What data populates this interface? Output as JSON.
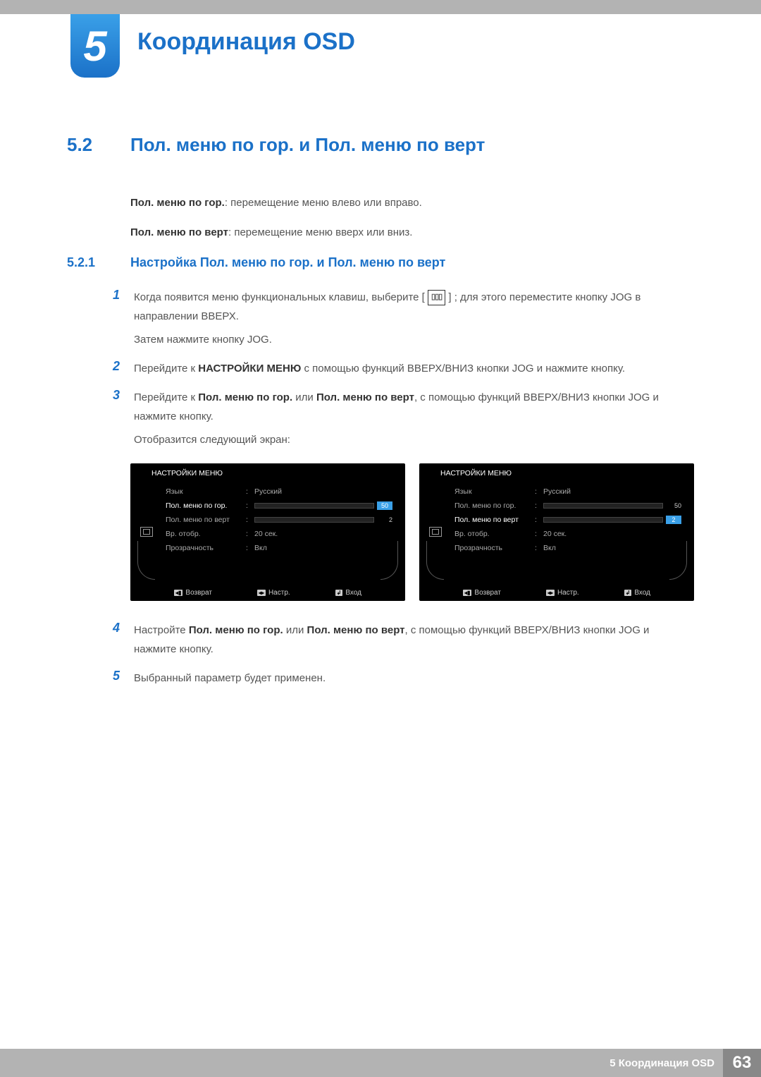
{
  "chapter": {
    "number": "5",
    "title": "Координация OSD"
  },
  "section": {
    "number": "5.2",
    "title": "Пол. меню по гор. и Пол. меню по верт"
  },
  "intro": {
    "line1_bold": "Пол. меню по гор.",
    "line1_rest": ": перемещение меню влево или вправо.",
    "line2_bold": "Пол. меню по верт",
    "line2_rest": ": перемещение меню вверх или вниз."
  },
  "subsection": {
    "number": "5.2.1",
    "title": "Настройка Пол. меню по гор. и Пол. меню по верт"
  },
  "steps": [
    {
      "num": "1",
      "pre": "Когда появится меню функциональных клавиш, выберите [",
      "post": "] ; для этого переместите кнопку JOG в направлении ВВЕРХ.",
      "sub": "Затем нажмите кнопку JOG."
    },
    {
      "num": "2",
      "t1": "Перейдите к ",
      "b1": "НАСТРОЙКИ МЕНЮ",
      "t2": " с помощью функций ВВЕРХ/ВНИЗ кнопки JOG и нажмите кнопку."
    },
    {
      "num": "3",
      "t1": "Перейдите к ",
      "b1": "Пол. меню по гор.",
      "t2": " или ",
      "b2": "Пол. меню по верт",
      "t3": ", с помощью функций ВВЕРХ/ВНИЗ кнопки JOG и нажмите кнопку.",
      "sub": "Отобразится следующий экран:"
    },
    {
      "num": "4",
      "t1": "Настройте ",
      "b1": "Пол. меню по гор.",
      "t2": " или ",
      "b2": "Пол. меню по верт",
      "t3": ", с помощью функций ВВЕРХ/ВНИЗ кнопки JOG и нажмите кнопку."
    },
    {
      "num": "5",
      "t1": "Выбранный параметр будет применен."
    }
  ],
  "osd": {
    "title": "НАСТРОЙКИ МЕНЮ",
    "rows": {
      "lang_label": "Язык",
      "lang_value": "Русский",
      "hpos_label": "Пол. меню по гор.",
      "hpos_value": "50",
      "vpos_label": "Пол. меню по верт",
      "vpos_value": "2",
      "time_label": "Вр. отобр.",
      "time_value": "20 сек.",
      "trans_label": "Прозрачность",
      "trans_value": "Вкл"
    },
    "footer": {
      "back": "Возврат",
      "adjust": "Настр.",
      "enter": "Вход"
    }
  },
  "footer": {
    "label": "5 Координация OSD",
    "page": "63"
  }
}
